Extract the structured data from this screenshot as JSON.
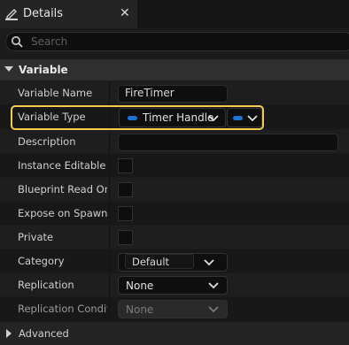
{
  "tab": {
    "title": "Details",
    "close": "✕",
    "icon": "edit-icon"
  },
  "search": {
    "placeholder": "Search",
    "icon": "search-icon"
  },
  "section": {
    "title": "Variable",
    "icon": "chevron-down-icon"
  },
  "rows": {
    "variable_name": {
      "label": "Variable Name",
      "value": "FireTimer"
    },
    "variable_type": {
      "label": "Variable Type",
      "value": "Timer Handle",
      "pin_color": "#1e73d6"
    },
    "description": {
      "label": "Description",
      "value": ""
    },
    "instance_editable": {
      "label": "Instance Editable",
      "checked": false
    },
    "blueprint_read_only": {
      "label": "Blueprint Read Only",
      "checked": false
    },
    "expose_on_spawn": {
      "label": "Expose on Spawn",
      "checked": false
    },
    "private": {
      "label": "Private",
      "checked": false
    },
    "category": {
      "label": "Category",
      "value": "Default"
    },
    "replication": {
      "label": "Replication",
      "value": "None"
    },
    "replication_condition": {
      "label": "Replication Conditio",
      "value": "None"
    }
  },
  "advanced": {
    "title": "Advanced",
    "icon": "chevron-right-icon"
  },
  "colors": {
    "highlight": "#f2cc4a",
    "accent": "#1e73d6",
    "background": "#1a1a1a"
  }
}
